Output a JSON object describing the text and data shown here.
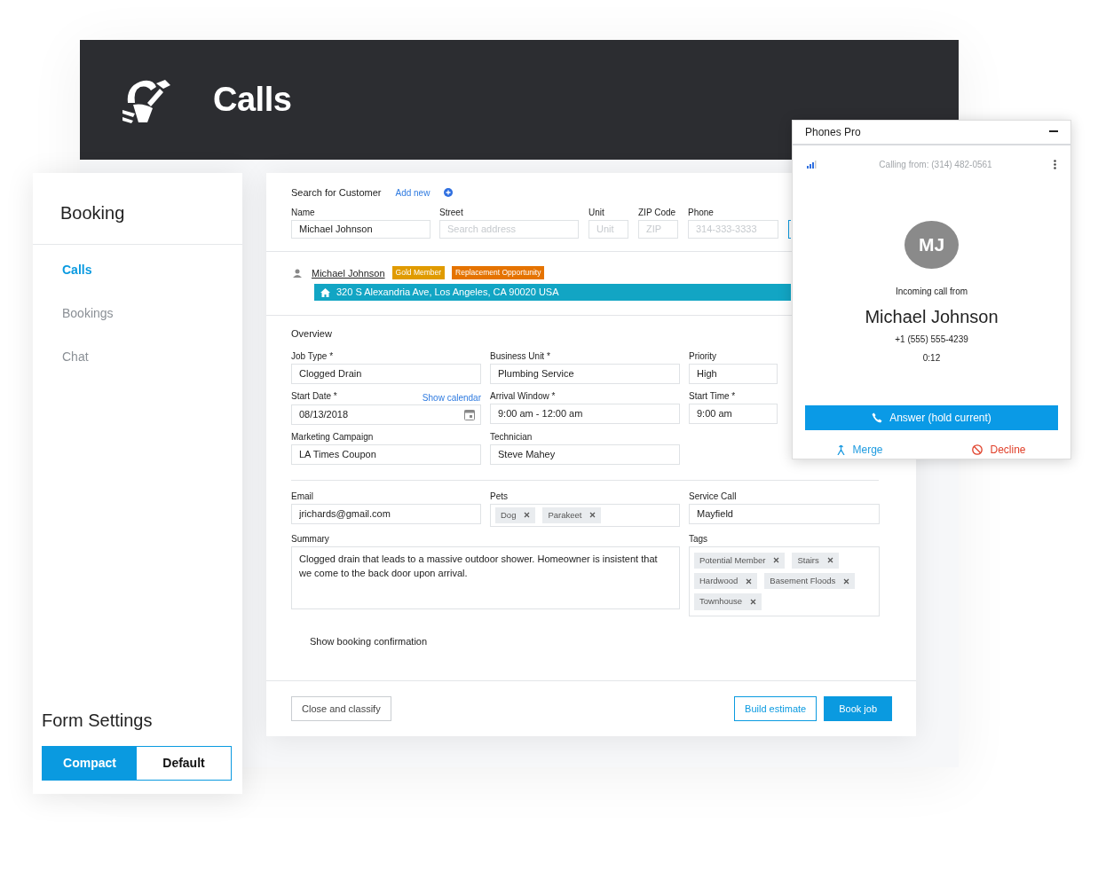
{
  "header": {
    "title": "Calls"
  },
  "sidebar": {
    "title": "Booking",
    "items": [
      {
        "label": "Calls",
        "selected": true
      },
      {
        "label": "Bookings",
        "selected": false
      },
      {
        "label": "Chat",
        "selected": false
      }
    ],
    "form_settings": {
      "title": "Form Settings",
      "options": [
        {
          "label": "Compact",
          "selected": true
        },
        {
          "label": "Default",
          "selected": false
        }
      ]
    }
  },
  "customer_search": {
    "title": "Search for Customer",
    "add_new": "Add new",
    "fields": [
      {
        "label": "Name",
        "value": "Michael Johnson"
      },
      {
        "label": "Street",
        "placeholder": "Search address"
      },
      {
        "label": "Unit",
        "placeholder": "Unit"
      },
      {
        "label": "ZIP Code",
        "placeholder": "ZIP"
      },
      {
        "label": "Phone",
        "placeholder": "314-333-3333"
      }
    ]
  },
  "customer": {
    "name": "Michael Johnson",
    "badges": [
      {
        "label": "Gold Member",
        "color": "#e09b00"
      },
      {
        "label": "Replacement Opportunity",
        "color": "#e57300"
      }
    ],
    "address": "320 S Alexandria Ave, Los Angeles, CA 90020 USA"
  },
  "overview": {
    "title": "Overview",
    "fields": [
      {
        "label": "Job Type *",
        "value": "Clogged Drain",
        "kind": "text"
      },
      {
        "label": "Business Unit *",
        "value": "Plumbing Service",
        "kind": "text"
      },
      {
        "label": "Priority",
        "value": "High",
        "kind": "text"
      },
      {
        "label": "Start Date *",
        "value": "08/13/2018",
        "kind": "date",
        "link": "Show calendar"
      },
      {
        "label": "Arrival Window *",
        "value": "9:00 am - 12:00 am",
        "kind": "text"
      },
      {
        "label": "Start Time *",
        "value": "9:00 am",
        "kind": "text"
      },
      {
        "label": "Marketing Campaign",
        "value": "LA Times Coupon",
        "kind": "text"
      },
      {
        "label": "Technician",
        "value": "Steve Mahey",
        "kind": "text"
      }
    ]
  },
  "details": {
    "email": {
      "label": "Email",
      "value": "jrichards@gmail.com"
    },
    "pets": {
      "label": "Pets",
      "tags": [
        "Dog",
        "Parakeet"
      ]
    },
    "service_call": {
      "label": "Service Call",
      "value": "Mayfield"
    },
    "summary": {
      "label": "Summary",
      "value": "Clogged drain that leads to a massive outdoor shower. Homeowner is insistent that we come to the back door upon arrival."
    },
    "tags": {
      "label": "Tags",
      "tags": [
        "Potential Member",
        "Stairs",
        "Hardwood",
        "Basement Floods",
        "Townhouse"
      ]
    }
  },
  "show_booking_confirmation": "Show booking confirmation",
  "footer": {
    "close": "Close and classify",
    "estimate": "Build estimate",
    "book": "Book job"
  },
  "phone": {
    "title": "Phones Pro",
    "calling_from": "Calling from: (314) 482-0561",
    "initials": "MJ",
    "incoming_label": "Incoming call from",
    "caller": "Michael Johnson",
    "number": "+1 (555) 555-4239",
    "duration": "0:12",
    "answer": "Answer (hold current)",
    "merge": "Merge",
    "decline": "Decline"
  }
}
